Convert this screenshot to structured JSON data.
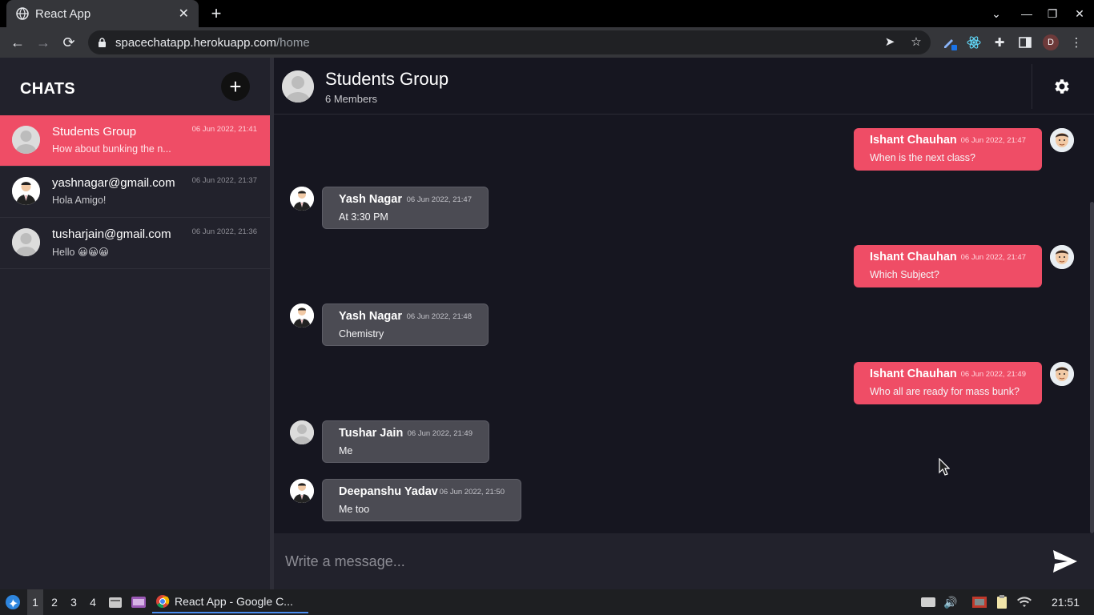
{
  "browser": {
    "tab_title": "React App",
    "url_host": "spacechatapp.herokuapp.com",
    "url_path": "/home",
    "profile_initial": "D"
  },
  "sidebar": {
    "title": "CHATS",
    "chats": [
      {
        "name": "Students Group",
        "preview": "How about bunking the n...",
        "time": "06 Jun 2022, 21:41",
        "active": true,
        "avatar": "default-avatar"
      },
      {
        "name": "yashnagar@gmail.com",
        "preview": "Hola Amigo!",
        "time": "06 Jun 2022, 21:37",
        "active": false,
        "avatar": "suit-avatar"
      },
      {
        "name": "tusharjain@gmail.com",
        "preview": "Hello 😀😀😀",
        "time": "06 Jun 2022, 21:36",
        "active": false,
        "avatar": "default-avatar"
      }
    ]
  },
  "conversation": {
    "name": "Students Group",
    "members": "6 Members",
    "messages": [
      {
        "sender": "Ishant Chauhan",
        "time": "06 Jun 2022, 21:47",
        "text": "When is the next class?",
        "direction": "out"
      },
      {
        "sender": "Yash Nagar",
        "time": "06 Jun 2022, 21:47",
        "text": "At 3:30 PM",
        "direction": "in"
      },
      {
        "sender": "Ishant Chauhan",
        "time": "06 Jun 2022, 21:47",
        "text": "Which Subject?",
        "direction": "out"
      },
      {
        "sender": "Yash Nagar",
        "time": "06 Jun 2022, 21:48",
        "text": "Chemistry",
        "direction": "in"
      },
      {
        "sender": "Ishant Chauhan",
        "time": "06 Jun 2022, 21:49",
        "text": "Who all are ready for mass bunk?",
        "direction": "out"
      },
      {
        "sender": "Tushar Jain",
        "time": "06 Jun 2022, 21:49",
        "text": "Me",
        "direction": "in"
      },
      {
        "sender": "Deepanshu Yadav",
        "time": "06 Jun 2022, 21:50",
        "text": "Me too",
        "direction": "in"
      }
    ]
  },
  "composer": {
    "placeholder": "Write a message..."
  },
  "taskbar": {
    "workspaces": [
      "1",
      "2",
      "3",
      "4"
    ],
    "window_title": "React App - Google C...",
    "clock": "21:51"
  },
  "colors": {
    "accent": "#ef4d66",
    "background": "#161620",
    "sidebar": "#22222c"
  }
}
